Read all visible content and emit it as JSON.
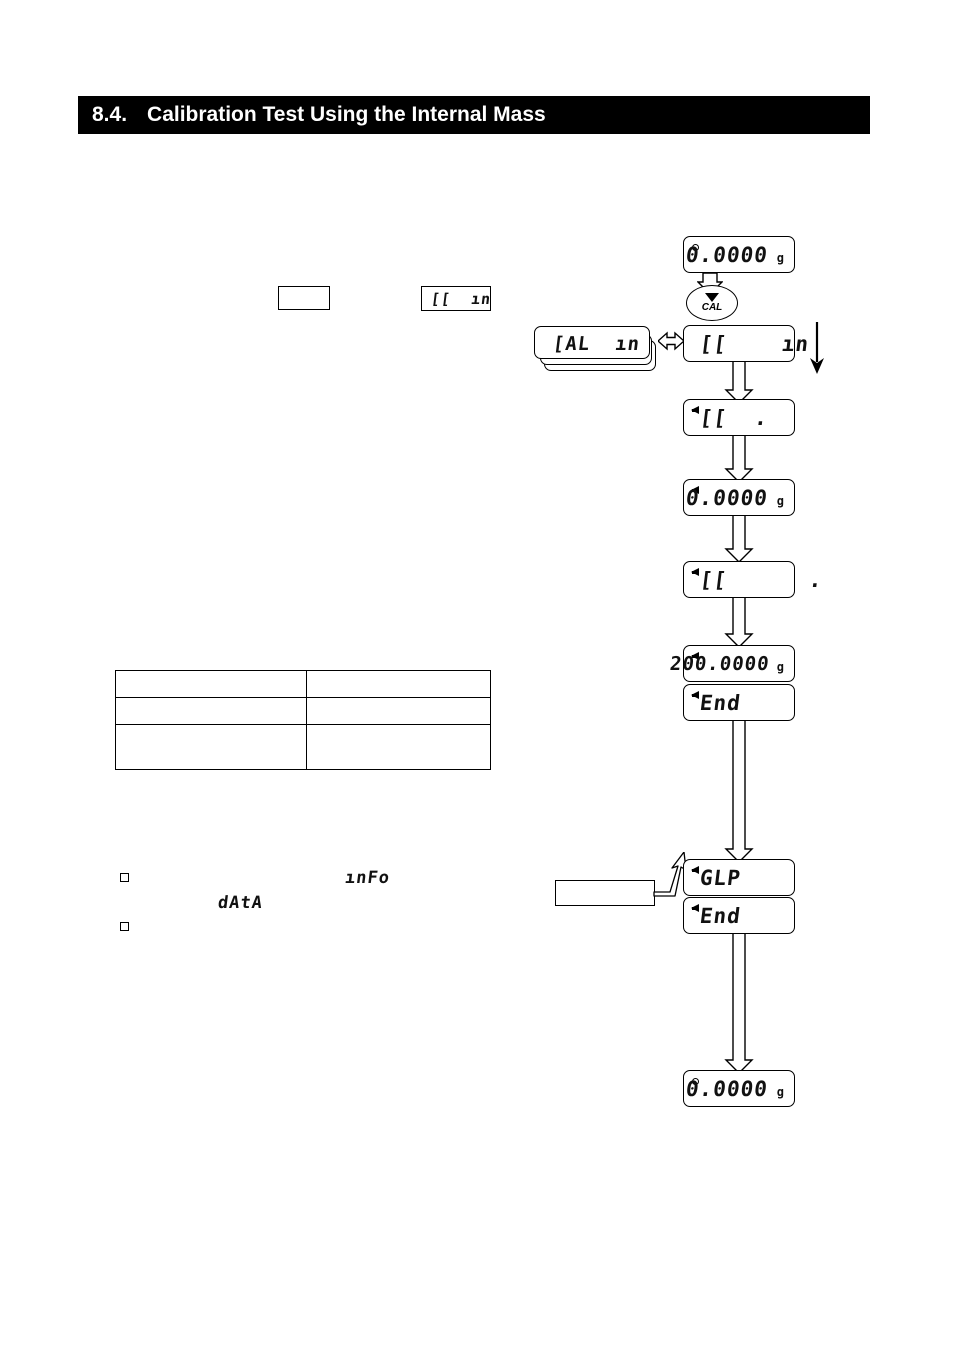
{
  "section": {
    "number": "8.4.",
    "title": "Calibration Test Using the Internal Mass"
  },
  "inline": {
    "key_box_label": "",
    "chip_display": "[[  ın"
  },
  "table": {
    "rows": [
      {
        "col1": "",
        "col2": ""
      },
      {
        "col1": "",
        "col2": ""
      },
      {
        "col1": "",
        "col2": ""
      }
    ]
  },
  "notes": [
    {
      "bullet": "□",
      "lcd_right": "ınFo",
      "lcd_below": "dAtA"
    },
    {
      "bullet": "□",
      "lcd_right": "",
      "lcd_below": ""
    }
  ],
  "callout": {
    "text": ""
  },
  "flow": {
    "indicator": {
      "label": "CAL",
      "icon": "down-triangle"
    },
    "alt_panel": {
      "value": "[AL  ın",
      "unit": ""
    },
    "panels": [
      {
        "id": "display-zero-top",
        "value": "0.0000",
        "unit": "g",
        "marker": "circle"
      },
      {
        "id": "display-cc-in",
        "value": "[[    ın",
        "unit": "",
        "marker": "none"
      },
      {
        "id": "display-cc-dot1",
        "value": "[[  .",
        "unit": "",
        "marker": "triangle"
      },
      {
        "id": "display-zero-mid",
        "value": "0.0000",
        "unit": "g",
        "marker": "triangle"
      },
      {
        "id": "display-cc-dot2",
        "value": "[[      .",
        "unit": "",
        "marker": "triangle"
      },
      {
        "id": "display-mass-200",
        "value": "200.0000",
        "unit": "g",
        "marker": "triangle"
      },
      {
        "id": "display-end-1",
        "value": "End",
        "unit": "",
        "marker": "triangle"
      },
      {
        "id": "display-glp",
        "value": "GLP",
        "unit": "",
        "marker": "triangle"
      },
      {
        "id": "display-end-2",
        "value": "End",
        "unit": "",
        "marker": "triangle"
      },
      {
        "id": "display-zero-bottom",
        "value": "0.0000",
        "unit": "g",
        "marker": "circle"
      }
    ]
  }
}
